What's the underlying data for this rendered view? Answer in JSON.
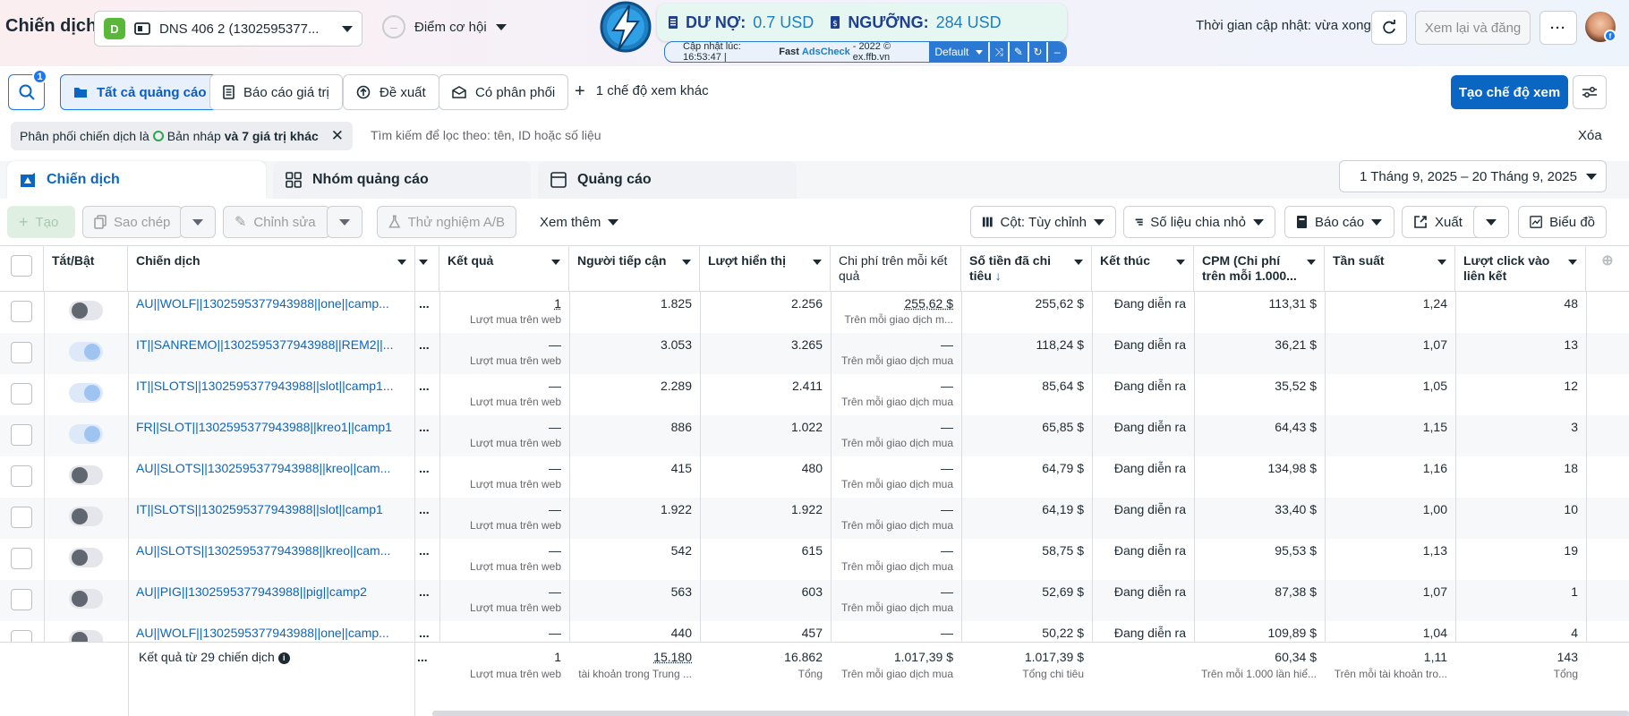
{
  "header": {
    "title": "Chiến dịch",
    "account_badge": "D",
    "account_name": "DNS 406 2 (1302595377...",
    "opportunity": "Điểm cơ hội",
    "update_text": "Thời gian cập nhật: vừa xong",
    "review_button": "Xem lại và đăng",
    "more": "···"
  },
  "extension": {
    "debt_label": "DƯ NỢ:",
    "debt_value": "0.7 USD",
    "threshold_label": "NGƯỠNG:",
    "threshold_value": "284 USD",
    "updated_at": "Cập nhật lúc: 16:53:47 |",
    "fast": "Fast",
    "adscheck": "AdsCheck",
    "copyright": "- 2022 © ex.ffb.vn",
    "profile": "Default"
  },
  "toolbar": {
    "search_badge": "1",
    "views": [
      "Tất cả quảng cáo",
      "Báo cáo giá trị",
      "Đề xuất",
      "Có phân phối"
    ],
    "more_views": "1 chế độ xem khác",
    "create_view": "Tạo chế độ xem"
  },
  "filter": {
    "chip_prefix": "Phân phối chiến dịch là",
    "chip_value": "Bản nháp",
    "chip_suffix": "và 7 giá trị khác",
    "search_placeholder": "Tìm kiếm để lọc theo: tên, ID hoặc số liệu",
    "clear": "Xóa"
  },
  "tabs": [
    "Chiến dịch",
    "Nhóm quảng cáo",
    "Quảng cáo"
  ],
  "date_range": "1 Tháng 9, 2025 – 20 Tháng 9, 2025",
  "actions": {
    "create": "Tạo",
    "copy": "Sao chép",
    "edit": "Chỉnh sửa",
    "ab_test": "Thử nghiệm A/B",
    "see_more": "Xem thêm",
    "columns": "Cột: Tùy chỉnh",
    "breakdown": "Số liệu chia nhỏ",
    "reports": "Báo cáo",
    "export": "Xuất",
    "chart": "Biểu đồ"
  },
  "columns": {
    "toggle": "Tắt/Bật",
    "name": "Chiến dịch",
    "result": "Kết quả",
    "reach": "Người tiếp cận",
    "impressions": "Lượt hiển thị",
    "cost_per_result": "Chi phí trên mỗi kết quả",
    "spent": "Số tiền đã chi tiêu",
    "end": "Kết thúc",
    "cpm": "CPM (Chi phí trên mỗi 1.000...",
    "frequency": "Tần suất",
    "link_clicks": "Lượt click vào liên kết"
  },
  "rows": [
    {
      "on": false,
      "name": "AU||WOLF||1302595377943988||one||camp...",
      "result": "1",
      "result_sub": "Lượt mua trên web",
      "reach": "1.825",
      "impressions": "2.256",
      "cpr": "255,62 $",
      "cpr_sub": "Trên mỗi giao dịch m...",
      "spent": "255,62 $",
      "end": "Đang diễn ra",
      "cpm": "113,31 $",
      "freq": "1,24",
      "clicks": "48"
    },
    {
      "on": true,
      "name": "IT||SANREMO||1302595377943988||REM2||...",
      "result": "—",
      "result_sub": "Lượt mua trên web",
      "reach": "3.053",
      "impressions": "3.265",
      "cpr": "—",
      "cpr_sub": "Trên mỗi giao dịch mua",
      "spent": "118,24 $",
      "end": "Đang diễn ra",
      "cpm": "36,21 $",
      "freq": "1,07",
      "clicks": "13"
    },
    {
      "on": true,
      "name": "IT||SLOTS||1302595377943988||slot||camp1...",
      "result": "—",
      "result_sub": "Lượt mua trên web",
      "reach": "2.289",
      "impressions": "2.411",
      "cpr": "—",
      "cpr_sub": "Trên mỗi giao dịch mua",
      "spent": "85,64 $",
      "end": "Đang diễn ra",
      "cpm": "35,52 $",
      "freq": "1,05",
      "clicks": "12"
    },
    {
      "on": true,
      "name": "FR||SLOT||1302595377943988||kreo1||camp1",
      "result": "—",
      "result_sub": "Lượt mua trên web",
      "reach": "886",
      "impressions": "1.022",
      "cpr": "—",
      "cpr_sub": "Trên mỗi giao dịch mua",
      "spent": "65,85 $",
      "end": "Đang diễn ra",
      "cpm": "64,43 $",
      "freq": "1,15",
      "clicks": "3"
    },
    {
      "on": false,
      "name": "AU||SLOTS||1302595377943988||kreo||cam...",
      "result": "—",
      "result_sub": "Lượt mua trên web",
      "reach": "415",
      "impressions": "480",
      "cpr": "—",
      "cpr_sub": "Trên mỗi giao dịch mua",
      "spent": "64,79 $",
      "end": "Đang diễn ra",
      "cpm": "134,98 $",
      "freq": "1,16",
      "clicks": "18"
    },
    {
      "on": false,
      "name": "IT||SLOTS||1302595377943988||slot||camp1",
      "result": "—",
      "result_sub": "Lượt mua trên web",
      "reach": "1.922",
      "impressions": "1.922",
      "cpr": "—",
      "cpr_sub": "Trên mỗi giao dịch mua",
      "spent": "64,19 $",
      "end": "Đang diễn ra",
      "cpm": "33,40 $",
      "freq": "1,00",
      "clicks": "10"
    },
    {
      "on": false,
      "name": "AU||SLOTS||1302595377943988||kreo||cam...",
      "result": "—",
      "result_sub": "Lượt mua trên web",
      "reach": "542",
      "impressions": "615",
      "cpr": "—",
      "cpr_sub": "Trên mỗi giao dịch mua",
      "spent": "58,75 $",
      "end": "Đang diễn ra",
      "cpm": "95,53 $",
      "freq": "1,13",
      "clicks": "19"
    },
    {
      "on": false,
      "name": "AU||PIG||1302595377943988||pig||camp2",
      "result": "—",
      "result_sub": "Lượt mua trên web",
      "reach": "563",
      "impressions": "603",
      "cpr": "—",
      "cpr_sub": "Trên mỗi giao dịch mua",
      "spent": "52,69 $",
      "end": "Đang diễn ra",
      "cpm": "87,38 $",
      "freq": "1,07",
      "clicks": "1"
    },
    {
      "on": false,
      "name": "AU||WOLF||1302595377943988||one||camp...",
      "result": "—",
      "result_sub": "",
      "reach": "440",
      "impressions": "457",
      "cpr": "—",
      "cpr_sub": "",
      "spent": "50,22 $",
      "end": "Đang diễn ra",
      "cpm": "109,89 $",
      "freq": "1,04",
      "clicks": "4"
    }
  ],
  "footer": {
    "label": "Kết quả từ 29 chiến dịch",
    "result": "1",
    "result_sub": "Lượt mua trên web",
    "reach": "15.180",
    "reach_sub": "tài khoản trong Trung ...",
    "impressions": "16.862",
    "impressions_sub": "Tổng",
    "cpr": "1.017,39 $",
    "cpr_sub": "Trên mỗi giao dịch mua",
    "spent": "1.017,39 $",
    "spent_sub": "Tổng chi tiêu",
    "cpm": "60,34 $",
    "cpm_sub": "Trên mỗi 1.000 lần hiể...",
    "freq": "1,11",
    "freq_sub": "Trên mỗi tài khoản tro...",
    "clicks": "143",
    "clicks_sub": "Tổng"
  }
}
